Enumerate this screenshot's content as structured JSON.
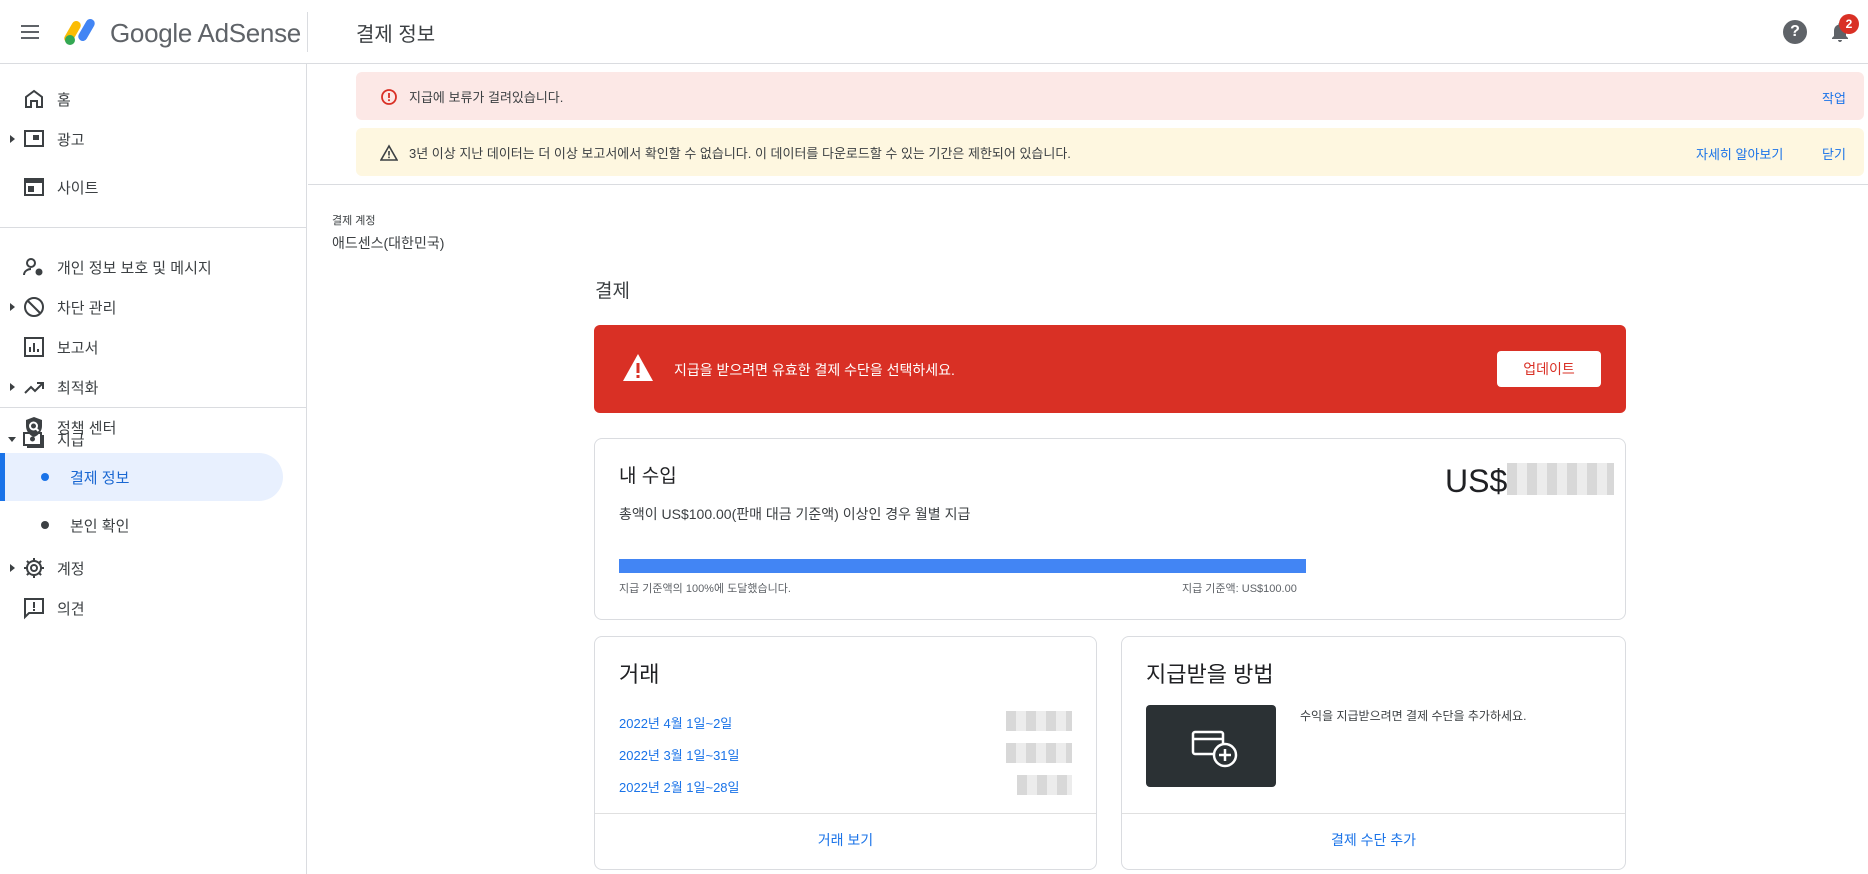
{
  "header": {
    "brand": "Google AdSense",
    "page_title": "결제 정보",
    "help_symbol": "?",
    "notification_count": "2"
  },
  "sidebar": {
    "items": [
      {
        "label": "홈",
        "icon": "home-icon"
      },
      {
        "label": "광고",
        "icon": "ads-icon"
      },
      {
        "label": "사이트",
        "icon": "sites-icon"
      },
      {
        "label": "개인 정보 보호 및 메시지",
        "icon": "privacy-icon"
      },
      {
        "label": "차단 관리",
        "icon": "block-icon"
      },
      {
        "label": "보고서",
        "icon": "reports-icon"
      },
      {
        "label": "최적화",
        "icon": "optimization-icon"
      },
      {
        "label": "정책 센터",
        "icon": "policy-icon"
      },
      {
        "label": "지급",
        "icon": "payments-icon"
      },
      {
        "label": "계정",
        "icon": "gear-icon"
      },
      {
        "label": "의견",
        "icon": "feedback-icon"
      }
    ],
    "payments_sub": [
      {
        "label": "결제 정보",
        "active": true
      },
      {
        "label": "본인 확인",
        "active": false
      }
    ]
  },
  "alerts": {
    "error_text": "지급에 보류가 걸려있습니다.",
    "error_action": "작업",
    "warn_text": "3년 이상 지난 데이터는 더 이상 보고서에서 확인할 수 없습니다. 이 데이터를 다운로드할 수 있는 기간은 제한되어 있습니다.",
    "warn_learn_more": "자세히 알아보기",
    "warn_close": "닫기"
  },
  "account": {
    "label": "결제 계정",
    "value": "애드센스(대한민국)"
  },
  "payments": {
    "section_title": "결제",
    "banner_text": "지급을 받으려면 유효한 결제 수단을 선택하세요.",
    "update_button": "업데이트"
  },
  "earnings": {
    "title": "내 수입",
    "subtitle": "총액이 US$100.00(판매 대금 기준액) 이상인 경우 월별 지급",
    "currency": "US$",
    "progress_percent": 100,
    "progress_left": "지급 기준액의 100%에 도달했습니다.",
    "progress_right": "지급 기준액: US$100.00"
  },
  "transactions": {
    "title": "거래",
    "rows": [
      "2022년 4월 1일~2일",
      "2022년 3월 1일~31일",
      "2022년 2월 1일~28일"
    ],
    "footer_link": "거래 보기"
  },
  "payment_method": {
    "title": "지급받을 방법",
    "text": "수익을 지급받으려면 결제 수단을 추가하세요.",
    "footer_link": "결제 수단 추가",
    "icon": "add-card-icon"
  },
  "colors": {
    "accent": "#1a73e8",
    "error": "#d93025",
    "error_bg": "#fce8e6",
    "warn_bg": "#fef7e0",
    "progress": "#4285f4"
  }
}
